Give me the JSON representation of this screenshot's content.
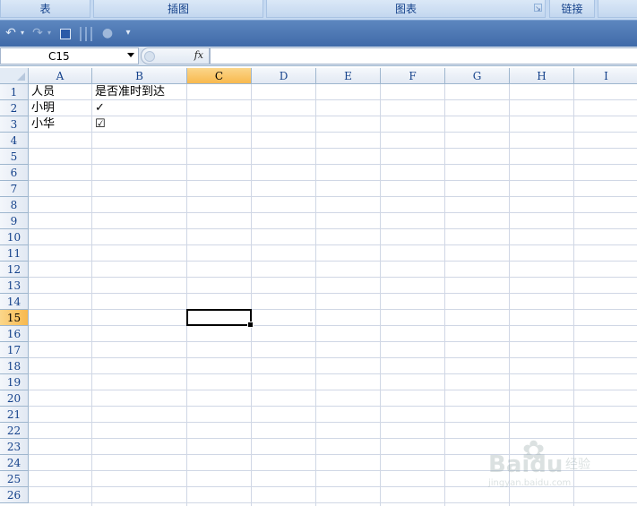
{
  "ribbon": {
    "groups": [
      {
        "label": "表"
      },
      {
        "label": "插图"
      },
      {
        "label": "图表"
      },
      {
        "label": "链接"
      }
    ]
  },
  "qat": {
    "undo_icon": "undo-icon",
    "redo_icon": "redo-icon",
    "save_icon": "save-icon",
    "customize_icon": "dropdown-icon"
  },
  "formula_bar": {
    "name_box": "C15",
    "fx_label": "fx",
    "formula": ""
  },
  "sheet": {
    "columns": [
      "A",
      "B",
      "C",
      "D",
      "E",
      "F",
      "G",
      "H",
      "I"
    ],
    "rows": [
      "1",
      "2",
      "3",
      "4",
      "5",
      "6",
      "7",
      "8",
      "9",
      "10",
      "11",
      "12",
      "13",
      "14",
      "15",
      "16",
      "17",
      "18",
      "19",
      "20",
      "21",
      "22",
      "23",
      "24",
      "25",
      "26"
    ],
    "active_column": "C",
    "active_row": "15",
    "cells": {
      "A1": "人员",
      "B1": "是否准时到达",
      "A2": "小明",
      "B2": "✓",
      "A3": "小华",
      "B3": "☑"
    }
  },
  "watermark": {
    "brand": "Baidu",
    "suffix": "经验",
    "url": "jingyan.baidu.com"
  },
  "colors": {
    "ribbon_bg": "#c5d9f1",
    "qat_bg": "#4a76b2",
    "header_active": "#f8b94e",
    "grid_line": "#d0d7e5",
    "header_text": "#15428b"
  }
}
